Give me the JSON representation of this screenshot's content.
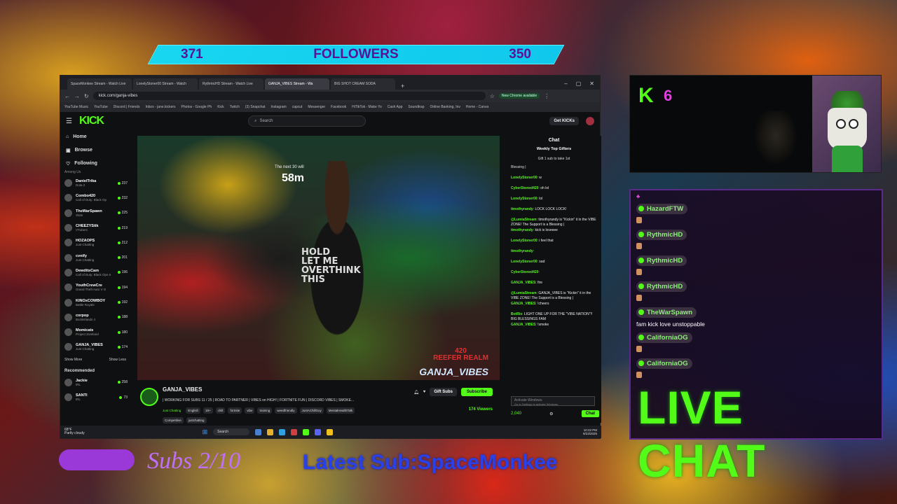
{
  "followers": {
    "left_count": "371",
    "label": "FOLLOWERS",
    "right_count": "350"
  },
  "browser": {
    "tabs": [
      "SpaceMonkee Stream - Watch Live",
      "LonelyStoner00 Stream - Watch",
      "RythmicHD Stream - Watch Live",
      "GANJA_VIBES Stream - Wa",
      "BIG SHOT CREAM SODA"
    ],
    "url": "kick.com/ganja-vibes",
    "chrome_badge": "New Chrome available",
    "bookmarks": [
      "YouTube Music",
      "YouTube",
      "Discord | Friends",
      "Inbox - jane.kickers",
      "Photos - Google Ph",
      "Kick",
      "Twitch",
      "(3) Snapchat",
      "Instagram",
      "capcut",
      "Messenger",
      "Facebook",
      "HiTikTok - Make Yo",
      "Cash App",
      "Soundtrap",
      "Online Banking, Inv",
      "Home - Canva"
    ]
  },
  "kick": {
    "logo": "KICK",
    "search_placeholder": "Search",
    "get_kicks": "Get KICKs",
    "nav": [
      "Home",
      "Browse",
      "Following"
    ],
    "among_us": "Among Us",
    "following": [
      {
        "name": "DanielTrika",
        "game": "Dota 2",
        "count": "237"
      },
      {
        "name": "Combo420",
        "game": "Call of Duty: Black Op",
        "count": "232"
      },
      {
        "name": "TheWarSpawn",
        "game": "Slots",
        "count": "225"
      },
      {
        "name": "CHEEZYStik",
        "game": "VTubers",
        "count": "219"
      },
      {
        "name": "HOZAOPS",
        "game": "Just Chatting",
        "count": "212"
      },
      {
        "name": "cvnify",
        "game": "Just Chatting",
        "count": "201"
      },
      {
        "name": "DewditsCam",
        "game": "Call of Duty: Black Ops 6",
        "count": "196"
      },
      {
        "name": "YouthCrewCre",
        "game": "Grand Theft Auto V G",
        "count": "194"
      },
      {
        "name": "KINOxCOWBOY",
        "game": "Battle Royale",
        "count": "192"
      },
      {
        "name": "corpop",
        "game": "Borderlands 4",
        "count": "188"
      },
      {
        "name": "Momicats",
        "game": "Project Zomboid",
        "count": "180"
      },
      {
        "name": "GANJA_VIBES",
        "game": "Just Chatting",
        "count": "174"
      }
    ],
    "show_more": "Show More",
    "show_less": "Show Less",
    "recommended_title": "Recommended",
    "recommended": [
      {
        "name": "Jackie",
        "game": "IRL",
        "count": "258"
      },
      {
        "name": "SANTI",
        "game": "IRL",
        "count": "73"
      }
    ]
  },
  "video": {
    "timer_label": "The next 30 will",
    "timer": "58m",
    "shirt_text": "HOLD\nLET ME\nOVERTHINK\nTHIS",
    "watermark": "GANJA_VIBES",
    "brand": "420\nREEFER REALM"
  },
  "stream": {
    "name": "GANJA_VIBES",
    "title": "| WORKING FOR SUBS 11 / 25 | ROAD TO PARTNER | VIBES on HIGH! | FORTNITE FUN | DISCORD VIBES | SMOKE...",
    "category": "Just Chatting",
    "tags": [
      "English",
      "18+",
      "chill",
      "fortnite",
      "vibe",
      "training",
      "weedfriendly",
      "JustAChillGuy",
      "MentalHealthTalk"
    ],
    "tags2": [
      "Competitive",
      "justchatting"
    ],
    "gift_subs": "Gift Subs",
    "subscribe": "Subscribe",
    "viewers": "174 Viewers"
  },
  "chat": {
    "title": "Chat",
    "top_gifters": "Weekly Top Gifters",
    "gift_prompt": "Gift 1 sub to take 1st",
    "first_line": "Blessing |",
    "messages": [
      {
        "user": "LonelyStoner00",
        "text": "w"
      },
      {
        "user": "CyberStoned420",
        "text": "oh lol"
      },
      {
        "user": "LonelyStoner00",
        "text": "lol"
      },
      {
        "user": "timothyrandy",
        "text": "LOCK LOCK LOCK!"
      },
      {
        "user": "@LumiaStream",
        "text": "timothyrandy is \"Kickin\" it in the VIBE ZONE! The Support is a Blessing |"
      },
      {
        "user": "timothyrandy",
        "text": "kick is loveeee"
      },
      {
        "user": "LonelyStoner00",
        "text": "i feel that"
      },
      {
        "user": "timothyrandy",
        "text": ""
      },
      {
        "user": "LonelyStoner00",
        "text": "sad"
      },
      {
        "user": "CyberStoned420",
        "text": ""
      },
      {
        "user": "GANJA_VIBES",
        "text": "fire"
      },
      {
        "user": "@LumiaStream",
        "text": "GANJA_VIBES is \"Kickin\" it in the VIBE ZONE! The Support is a Blessing |"
      },
      {
        "user": "GANJA_VIBES",
        "text": "!cheers"
      },
      {
        "user": "BotRix",
        "text": "LIGHT ONE UP FOR THE \"VIBE NATION\"!! BIG BLESSINGS FAM"
      },
      {
        "user": "GANJA_VIBES",
        "text": "!smoke"
      }
    ],
    "input_placeholder": "Activate Windows",
    "input_hint": "Go to Settings to activate Windows.",
    "points": "2,040",
    "chat_button": "Chat"
  },
  "taskbar": {
    "weather_temp": "68°F",
    "weather_desc": "Partly cloudy",
    "search": "Search",
    "time": "10:22 PM",
    "date": "9/23/2025"
  },
  "webcam": {
    "k": "K",
    "count": "6"
  },
  "live_chat": {
    "messages": [
      {
        "user": "HazardFTW",
        "text": ""
      },
      {
        "user": "RythmicHD",
        "text": ""
      },
      {
        "user": "RythmicHD",
        "text": ""
      },
      {
        "user": "RythmicHD",
        "text": ""
      },
      {
        "user": "TheWarSpawn",
        "text": "fam kick love unstoppable"
      },
      {
        "user": "CaliforniaOG",
        "text": ""
      },
      {
        "user": "CaliforniaOG",
        "text": ""
      }
    ],
    "title": "LIVE CHAT"
  },
  "ticker": {
    "subs": "Subs 2/10",
    "latest_sub": "Latest Sub:SpaceMonkee"
  }
}
